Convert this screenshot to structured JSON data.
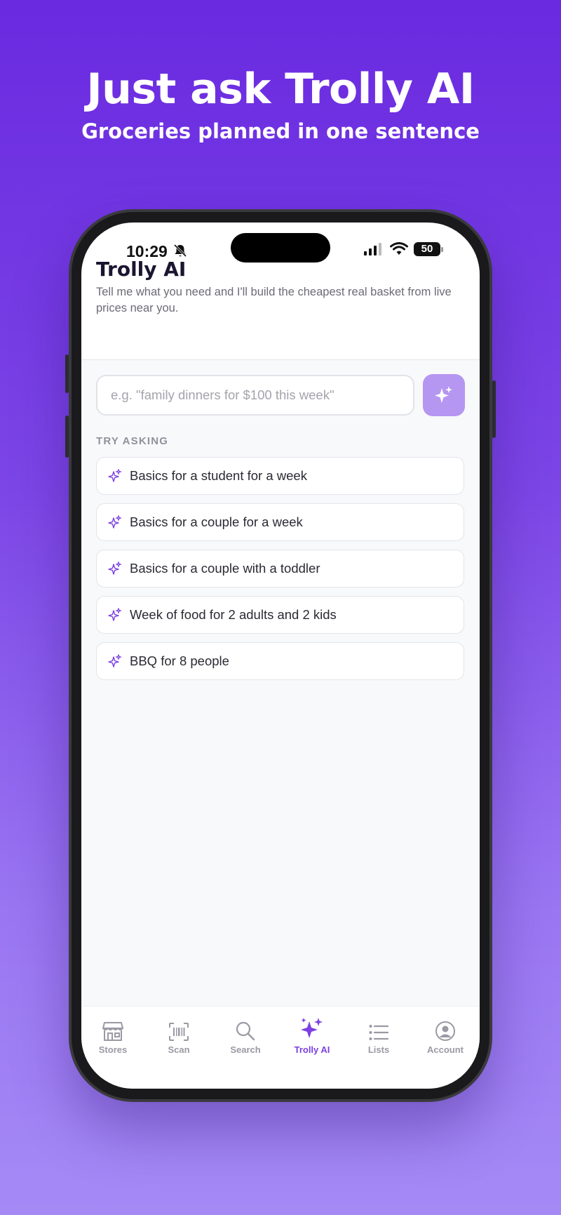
{
  "promo": {
    "headline": "Just ask Trolly AI",
    "subhead": "Groceries planned in one sentence"
  },
  "status_bar": {
    "time": "10:29",
    "battery": "50"
  },
  "header": {
    "title": "Trolly AI",
    "description": "Tell me what you need and I'll build the cheapest real basket from live prices near you."
  },
  "search": {
    "placeholder": "e.g. \"family dinners for $100 this week\""
  },
  "suggestions": {
    "label": "TRY ASKING",
    "items": [
      "Basics for a student for a week",
      "Basics for a couple for a week",
      "Basics for a couple with a toddler",
      "Week of food for 2 adults and 2 kids",
      "BBQ for 8 people"
    ]
  },
  "tabs": [
    {
      "label": "Stores",
      "icon": "store-icon"
    },
    {
      "label": "Scan",
      "icon": "barcode-icon"
    },
    {
      "label": "Search",
      "icon": "search-icon"
    },
    {
      "label": "Trolly AI",
      "icon": "sparkles-icon",
      "active": true
    },
    {
      "label": "Lists",
      "icon": "list-icon"
    },
    {
      "label": "Account",
      "icon": "account-icon"
    }
  ],
  "colors": {
    "accent": "#7b3fe3",
    "send_button": "#b596f1",
    "background_top": "#6a2ae0",
    "background_bottom": "#a58af6"
  }
}
